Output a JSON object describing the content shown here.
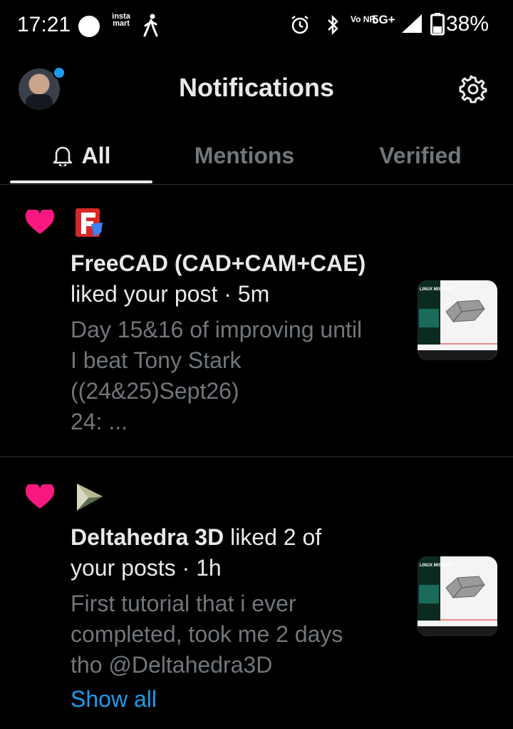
{
  "status_bar": {
    "time": "17:21",
    "instamart": "insta mart",
    "network_volte": "Vo NR",
    "network_5g": "5G+",
    "battery_pct": "38%",
    "icons": [
      "white-circle-icon",
      "instamart-icon",
      "walking-icon",
      "alarm-icon",
      "bluetooth-icon",
      "signal-icon",
      "battery-icon"
    ]
  },
  "header": {
    "title": "Notifications",
    "avatar_has_unread": true,
    "settings_icon": "gear-icon"
  },
  "tabs": [
    {
      "label": "All",
      "active": true,
      "icon": "bell-icon"
    },
    {
      "label": "Mentions",
      "active": false
    },
    {
      "label": "Verified",
      "active": false
    }
  ],
  "notifications": [
    {
      "type": "like",
      "icon": "heart-icon",
      "actor_logo": "freecad-logo",
      "actor": "FreeCAD (CAD+CAM+CAE)",
      "action": "liked your post",
      "time": "5m",
      "snippet": [
        "Day 15&16 of improving until",
        "I beat Tony Stark",
        "((24&25)Sept26)",
        "24: ..."
      ],
      "thumbnail_caption": "LINUX MISTAKE"
    },
    {
      "type": "like",
      "icon": "heart-icon",
      "actor_logo": "deltahedra-logo",
      "actor": "Deltahedra 3D",
      "action_part1": "liked 2 of",
      "action_part2": "your posts",
      "time": "1h",
      "snippet": [
        "First tutorial that i ever",
        "completed, took me 2 days",
        "tho @Deltahedra3D"
      ],
      "show_all": "Show all",
      "thumbnail_caption": "LINUX MISTAKE"
    }
  ],
  "colors": {
    "background": "#000000",
    "primary_text": "#e7e9ea",
    "secondary_text": "#71767b",
    "accent": "#1d9bf0",
    "heart": "#f91880",
    "divider": "#2f3336"
  }
}
